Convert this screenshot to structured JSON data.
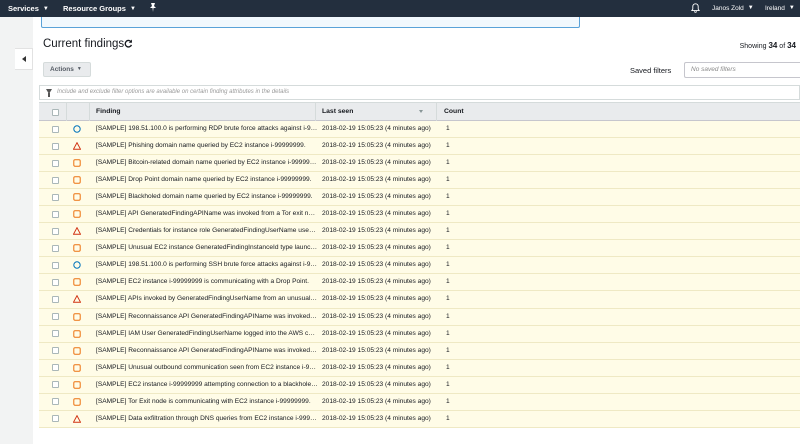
{
  "nav": {
    "services": "Services",
    "resource_groups": "Resource Groups",
    "user": "Janos Zold",
    "region": "Ireland"
  },
  "page": {
    "title": "Current findings",
    "showing_label": "Showing",
    "showing_count": "34",
    "showing_of": "of",
    "showing_total": "34"
  },
  "toolbar": {
    "actions_label": "Actions",
    "saved_filters_label": "Saved filters",
    "saved_filters_placeholder": "No saved filters"
  },
  "filter": {
    "hint": "Include and exclude filter options are available on certain finding attributes in the details"
  },
  "table": {
    "headers": {
      "finding": "Finding",
      "last_seen": "Last seen",
      "count": "Count"
    },
    "rows": [
      {
        "severity": "low",
        "finding": "[SAMPLE] 198.51.100.0 is performing RDP brute force attacks against i-99999999.",
        "last_seen": "2018-02-19 15:05:23 (4 minutes ago)",
        "count": "1"
      },
      {
        "severity": "high",
        "finding": "[SAMPLE] Phishing domain name queried by EC2 instance i-99999999.",
        "last_seen": "2018-02-19 15:05:23 (4 minutes ago)",
        "count": "1"
      },
      {
        "severity": "medium",
        "finding": "[SAMPLE] Bitcoin-related domain name queried by EC2 instance i-99999999.",
        "last_seen": "2018-02-19 15:05:23 (4 minutes ago)",
        "count": "1"
      },
      {
        "severity": "medium",
        "finding": "[SAMPLE] Drop Point domain name queried by EC2 instance i-99999999.",
        "last_seen": "2018-02-19 15:05:23 (4 minutes ago)",
        "count": "1"
      },
      {
        "severity": "medium",
        "finding": "[SAMPLE] Blackholed domain name queried by EC2 instance i-99999999.",
        "last_seen": "2018-02-19 15:05:23 (4 minutes ago)",
        "count": "1"
      },
      {
        "severity": "medium",
        "finding": "[SAMPLE] API GeneratedFindingAPIName was invoked from a Tor exit node.",
        "last_seen": "2018-02-19 15:05:23 (4 minutes ago)",
        "count": "1"
      },
      {
        "severity": "high",
        "finding": "[SAMPLE] Credentials for instance role GeneratedFindingUserName used from external IP.",
        "last_seen": "2018-02-19 15:05:23 (4 minutes ago)",
        "count": "1"
      },
      {
        "severity": "medium",
        "finding": "[SAMPLE] Unusual EC2 instance GeneratedFindingInstanceId type launched.",
        "last_seen": "2018-02-19 15:05:23 (4 minutes ago)",
        "count": "1"
      },
      {
        "severity": "low",
        "finding": "[SAMPLE] 198.51.100.0 is performing SSH brute force attacks against i-99999999.",
        "last_seen": "2018-02-19 15:05:23 (4 minutes ago)",
        "count": "1"
      },
      {
        "severity": "medium",
        "finding": "[SAMPLE] EC2 instance i-99999999 is communicating with a Drop Point.",
        "last_seen": "2018-02-19 15:05:23 (4 minutes ago)",
        "count": "1"
      },
      {
        "severity": "high",
        "finding": "[SAMPLE] APIs invoked by GeneratedFindingUserName from an unusual network.",
        "last_seen": "2018-02-19 15:05:23 (4 minutes ago)",
        "count": "1"
      },
      {
        "severity": "medium",
        "finding": "[SAMPLE] Reconnaissance API GeneratedFindingAPIName was invoked from a known malicious IP.",
        "last_seen": "2018-02-19 15:05:23 (4 minutes ago)",
        "count": "1"
      },
      {
        "severity": "medium",
        "finding": "[SAMPLE] IAM User GeneratedFindingUserName logged into the AWS console.",
        "last_seen": "2018-02-19 15:05:23 (4 minutes ago)",
        "count": "1"
      },
      {
        "severity": "medium",
        "finding": "[SAMPLE] Reconnaissance API GeneratedFindingAPIName was invoked from an unusual network.",
        "last_seen": "2018-02-19 15:05:23 (4 minutes ago)",
        "count": "1"
      },
      {
        "severity": "medium",
        "finding": "[SAMPLE] Unusual outbound communication seen from EC2 instance i-99999999.",
        "last_seen": "2018-02-19 15:05:23 (4 minutes ago)",
        "count": "1"
      },
      {
        "severity": "medium",
        "finding": "[SAMPLE] EC2 instance i-99999999 attempting connection to a blackholed IP address.",
        "last_seen": "2018-02-19 15:05:23 (4 minutes ago)",
        "count": "1"
      },
      {
        "severity": "medium",
        "finding": "[SAMPLE] Tor Exit node is communicating with EC2 instance i-99999999.",
        "last_seen": "2018-02-19 15:05:23 (4 minutes ago)",
        "count": "1"
      },
      {
        "severity": "high",
        "finding": "[SAMPLE] Data exfiltration through DNS queries from EC2 instance i-99999999.",
        "last_seen": "2018-02-19 15:05:23 (4 minutes ago)",
        "count": "1"
      }
    ]
  },
  "colors": {
    "nav_bg": "#232f3e",
    "row_bg": "#fffce7",
    "severity_high": "#d13212",
    "severity_medium": "#ec7211",
    "severity_low": "#0073bb"
  },
  "icons": {
    "high": "warning-triangle-icon",
    "medium": "warning-square-icon",
    "low": "info-circle-icon"
  }
}
